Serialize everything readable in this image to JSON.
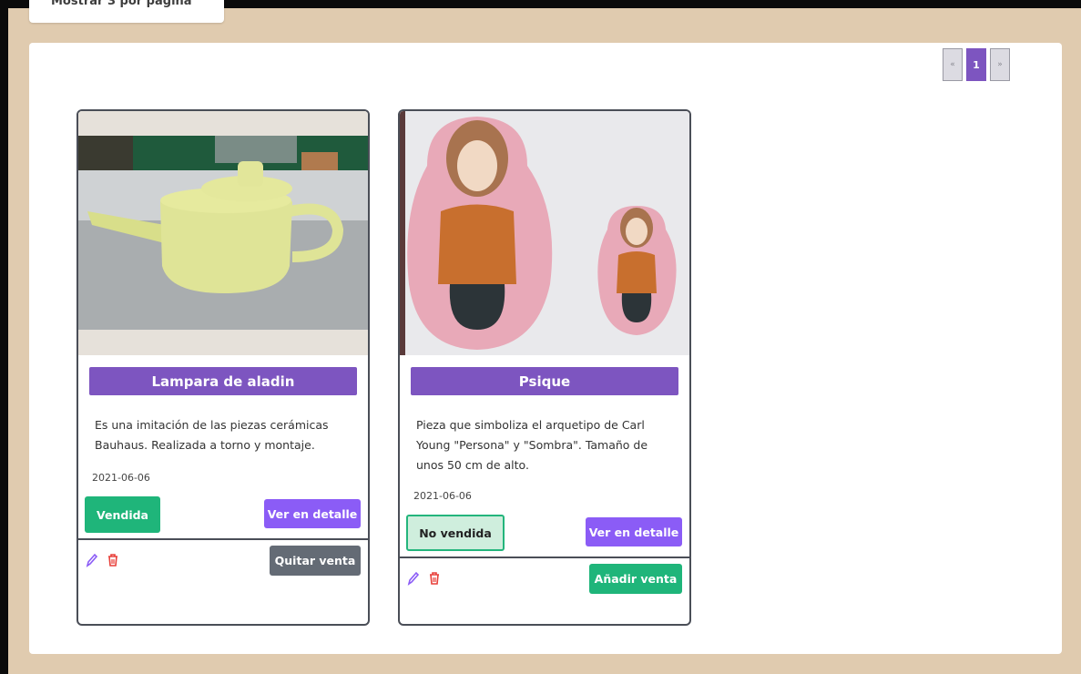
{
  "per_page": {
    "label": "Mostrar 3 por página ˅"
  },
  "pagination": {
    "prev": "«",
    "current": "1",
    "next": "»"
  },
  "products": [
    {
      "title": "Lampara de aladin",
      "description": "Es una imitación de las piezas cerámicas Bauhaus. Realizada a torno y montaje.",
      "date": "2021-06-06",
      "status_label": "Vendida",
      "detail_label": "Ver en detalle",
      "sale_action_label": "Quitar venta"
    },
    {
      "title": "Psique",
      "description": "Pieza que simboliza el arquetipo de Carl Young \"Persona\" y \"Sombra\". Tamaño de unos 50 cm de alto.",
      "date": "2021-06-06",
      "status_label": "No vendida",
      "detail_label": "Ver en detalle",
      "sale_action_label": "Añadir venta"
    }
  ],
  "icons": {
    "edit": "pencil-icon",
    "delete": "trash-icon"
  },
  "colors": {
    "accent": "#7d55c0",
    "detail_button": "#8b5cf6",
    "sold": "#1fb57a",
    "unsold_bg": "#cfeedd",
    "remove_button": "#646b75",
    "delete_icon": "#e8413b",
    "page_background": "#e0cbaf"
  }
}
